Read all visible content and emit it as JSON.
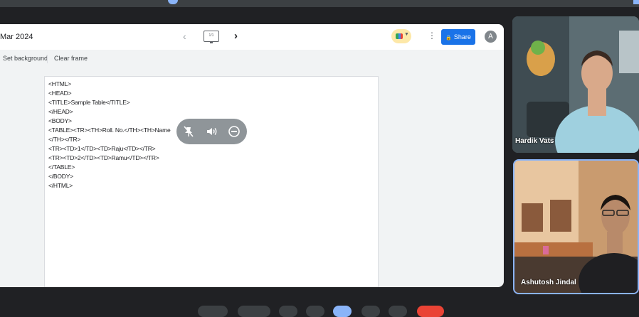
{
  "slide": {
    "title": "Mar 2024",
    "frame_counter": "1/1",
    "share_label": "Share",
    "avatar_letter": "A",
    "toolbar": {
      "set_background": "Set background",
      "clear_frame": "Clear frame"
    },
    "code_lines": [
      "<HTML>",
      "<HEAD>",
      "<TITLE>Sample Table</TITLE>",
      "</HEAD>",
      "<BODY>",
      "<TABLE><TR><TH>Roll. No.</TH><TH>Name",
      "</TH></TR>",
      "<TR><TD>1</TD><TD>Raju</TD></TR>",
      "<TR><TD>2</TD><TD>Ramu</TD></TR>",
      "</TABLE>",
      "</BODY>",
      "</HTML>"
    ]
  },
  "participants": [
    {
      "name": "Hardik Vats"
    },
    {
      "name": "Ashutosh Jindal"
    }
  ],
  "tile_controls": [
    "unpin-icon",
    "volume-icon",
    "remove-icon"
  ],
  "colors": {
    "accent": "#1a73e8",
    "active_speaker": "#8ab4f8",
    "end_call": "#ea4335"
  }
}
